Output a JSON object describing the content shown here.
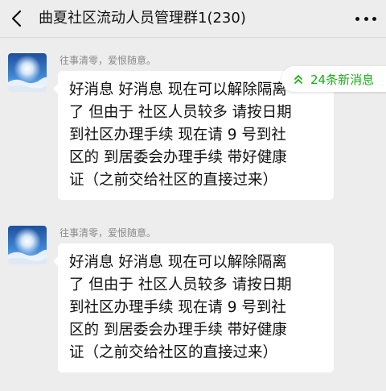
{
  "header": {
    "title": "曲夏社区流动人员管理群1(230)",
    "back_icon": "chevron-left-icon",
    "more_icon": "more-dots-icon"
  },
  "new_messages": {
    "label": "24条新消息",
    "icon": "double-chevron-up-icon",
    "color": "#1aad19"
  },
  "messages": [
    {
      "sender": "往事清零，爱恨随意。",
      "lines": [
        "好消息  好消息   现在可以解除隔离",
        "了  但由于 社区人员较多 请按日期",
        "到社区办理手续    现在请 9 号到社",
        "区的 到居委会办理手续  带好健康",
        "证（之前交给社区的直接过来）"
      ]
    },
    {
      "sender": "往事清零，爱恨随意。",
      "lines": [
        "好消息  好消息   现在可以解除隔离",
        "了  但由于 社区人员较多 请按日期",
        "到社区办理手续    现在请 9 号到社",
        "区的 到居委会办理手续  带好健康",
        "证（之前交给社区的直接过来）"
      ]
    }
  ]
}
